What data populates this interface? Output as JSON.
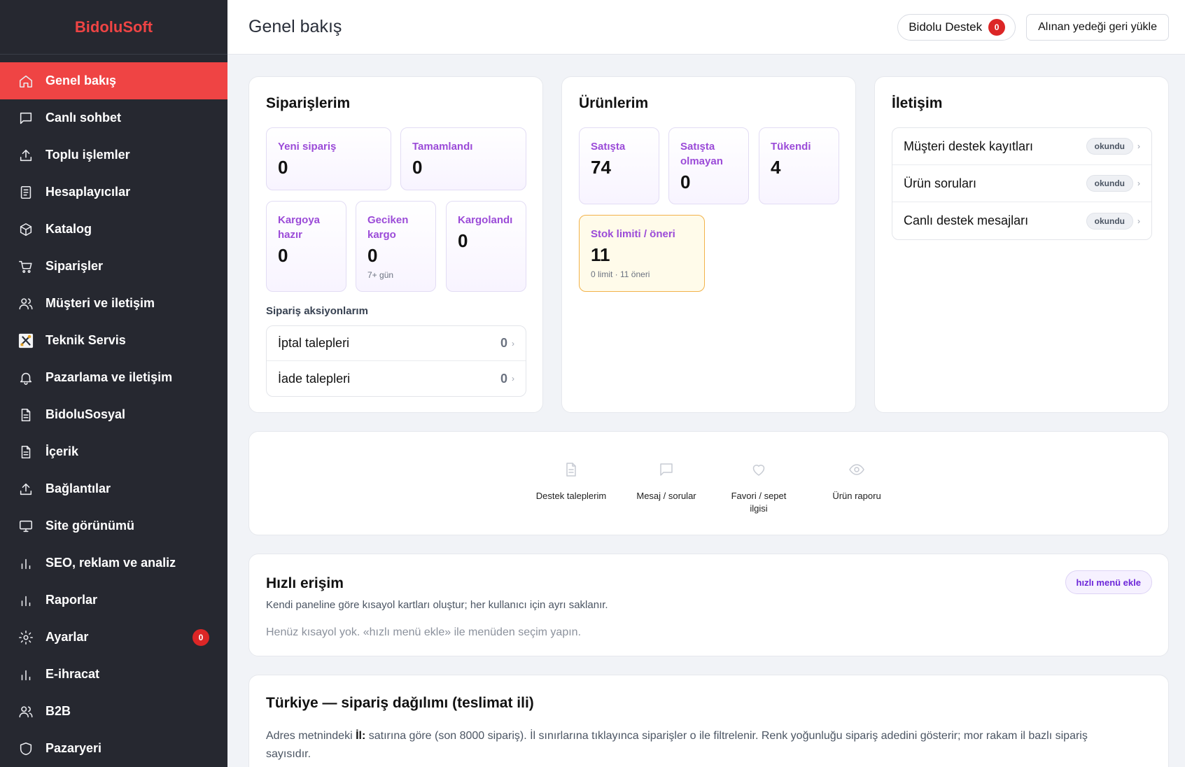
{
  "brand": "BidoluSoft",
  "sidebar": {
    "items": [
      {
        "label": "Genel bakış",
        "icon": "home-icon"
      },
      {
        "label": "Canlı sohbet",
        "icon": "chat-icon"
      },
      {
        "label": "Toplu işlemler",
        "icon": "upload-icon"
      },
      {
        "label": "Hesaplayıcılar",
        "icon": "document-icon"
      },
      {
        "label": "Katalog",
        "icon": "box-icon"
      },
      {
        "label": "Siparişler",
        "icon": "cart-icon"
      },
      {
        "label": "Müşteri ve iletişim",
        "icon": "users-icon"
      },
      {
        "label": "Teknik Servis",
        "icon": "tools-icon"
      },
      {
        "label": "Pazarlama ve iletişim",
        "icon": "bell-icon"
      },
      {
        "label": "BidoluSosyal",
        "icon": "file-icon"
      },
      {
        "label": "İçerik",
        "icon": "file-icon"
      },
      {
        "label": "Bağlantılar",
        "icon": "upload-icon"
      },
      {
        "label": "Site görünümü",
        "icon": "monitor-icon"
      },
      {
        "label": "SEO, reklam ve analiz",
        "icon": "bar-chart-icon"
      },
      {
        "label": "Raporlar",
        "icon": "bar-chart-icon"
      },
      {
        "label": "Ayarlar",
        "icon": "gear-icon",
        "badge": "0"
      },
      {
        "label": "E-ihracat",
        "icon": "bar-chart-icon"
      },
      {
        "label": "B2B",
        "icon": "users-icon"
      },
      {
        "label": "Pazaryeri",
        "icon": "shield-icon"
      }
    ]
  },
  "header": {
    "title": "Genel bakış",
    "support_label": "Bidolu Destek",
    "support_badge": "0",
    "restore_label": "Alınan yedeği geri yükle"
  },
  "orders": {
    "title": "Siparişlerim",
    "stats": [
      {
        "label": "Yeni sipariş",
        "value": "0"
      },
      {
        "label": "Tamamlandı",
        "value": "0"
      },
      {
        "label": "Kargoya hazır",
        "value": "0"
      },
      {
        "label": "Geciken kargo",
        "value": "0",
        "sub": "7+ gün"
      },
      {
        "label": "Kargolandı",
        "value": "0"
      }
    ],
    "actions_title": "Sipariş aksiyonlarım",
    "actions": [
      {
        "label": "İptal talepleri",
        "count": "0"
      },
      {
        "label": "İade talepleri",
        "count": "0"
      }
    ]
  },
  "products": {
    "title": "Ürünlerim",
    "stats": [
      {
        "label": "Satışta",
        "value": "74"
      },
      {
        "label": "Satışta olmayan",
        "value": "0"
      },
      {
        "label": "Tükendi",
        "value": "4"
      }
    ],
    "stock": {
      "label": "Stok limiti / öneri",
      "value": "11",
      "sub": "0 limit · 11 öneri"
    }
  },
  "contact": {
    "title": "İletişim",
    "items": [
      {
        "label": "Müşteri destek kayıtları",
        "status": "okundu"
      },
      {
        "label": "Ürün soruları",
        "status": "okundu"
      },
      {
        "label": "Canlı destek mesajları",
        "status": "okundu"
      }
    ]
  },
  "shortcuts": [
    {
      "label": "Destek taleplerim",
      "icon": "document-icon"
    },
    {
      "label": "Mesaj / sorular",
      "icon": "chat-icon"
    },
    {
      "label": "Favori / sepet ilgisi",
      "icon": "heart-icon"
    },
    {
      "label": "Ürün raporu",
      "icon": "eye-icon"
    }
  ],
  "quick": {
    "title": "Hızlı erişim",
    "description": "Kendi paneline göre kısayol kartları oluştur; her kullanıcı için ayrı saklanır.",
    "empty": "Henüz kısayol yok. «hızlı menü ekle» ile menüden seçim yapın.",
    "button": "hızlı menü ekle"
  },
  "map": {
    "title": "Türkiye — sipariş dağılımı (teslimat ili)",
    "desc_prefix": "Adres metnindeki",
    "desc_bold": "İl:",
    "desc_rest": "satırına göre (son 8000 sipariş). İl sınırlarına tıklayınca siparişler o ile filtrelenir. Renk yoğunluğu sipariş adedini gösterir; mor rakam il bazlı sipariş sayısıdır."
  },
  "colors": {
    "accent": "#ef4444",
    "sidebar": "#262830",
    "stat_label": "#9b4bd8",
    "warning_border": "#f2b24a"
  }
}
